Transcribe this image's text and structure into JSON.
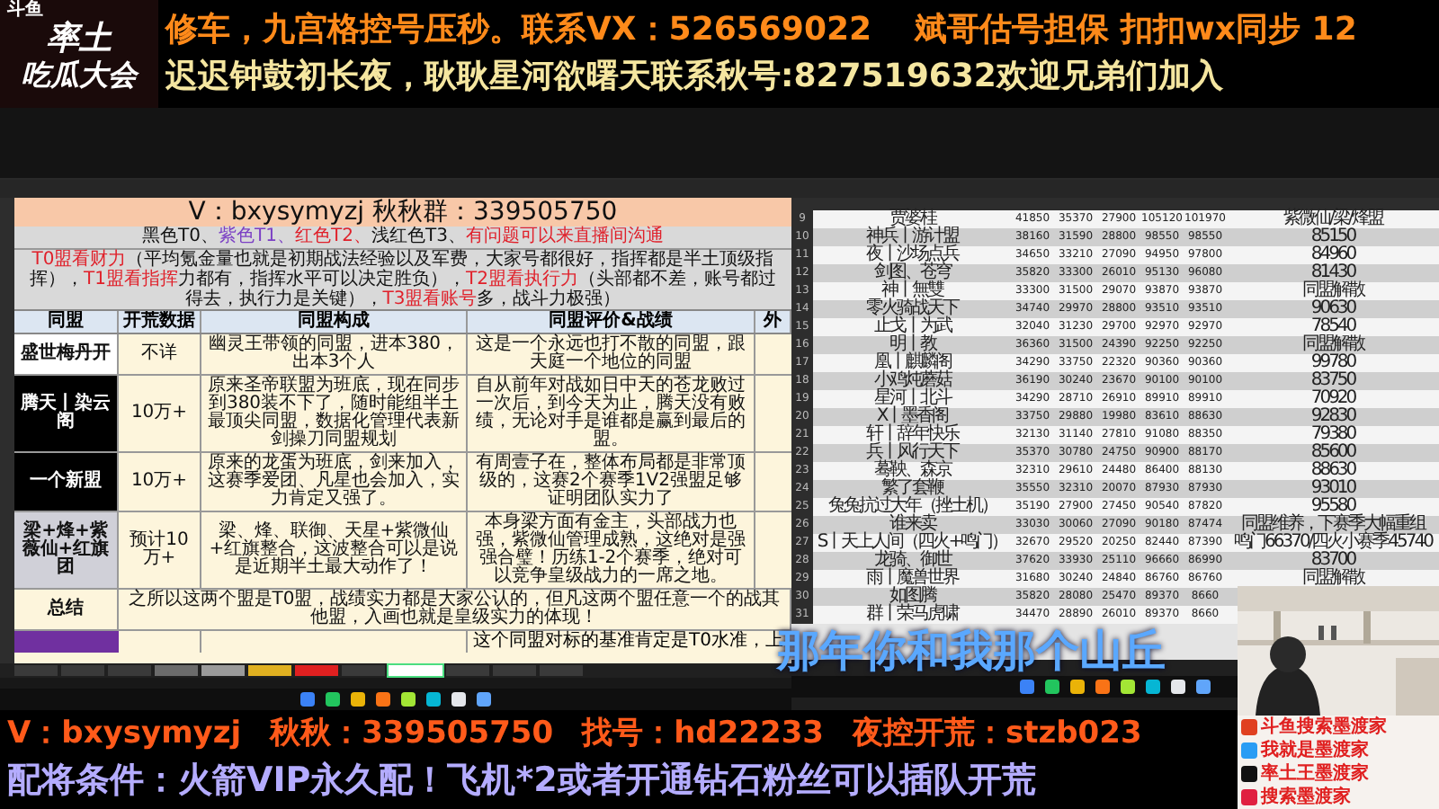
{
  "overlay_top": {
    "logo": {
      "platform": "斗鱼",
      "title_1": "率土",
      "title_2": "吃瓜大会"
    },
    "lines": [
      "修车，九宫格控号压秒。联系VX：526569022",
      "斌哥估号担保 扣扣wx同步 12",
      "迟迟钟鼓初长夜，耿耿星河欲曙天联系秋号:827519632欢迎兄弟们加入"
    ]
  },
  "left_sheet": {
    "banner": "V：bxysymyzj 秋秋群：339505750",
    "legend": [
      {
        "text": "黑色T0、",
        "color": "#111111"
      },
      {
        "text": "紫色T1、",
        "color": "#7b3fc4"
      },
      {
        "text": "红色T2、",
        "color": "#e0202a"
      },
      {
        "text": "浅红色T3、",
        "color": "#111111"
      },
      {
        "text": "有问题可以来直播间沟通",
        "color": "#e0202a"
      }
    ],
    "description": [
      {
        "text": "T0盟看财力",
        "color": "#e0202a"
      },
      {
        "text": "（平均氪金量也就是初期战法经验以及军费，大家号都很好，指挥都是半土顶级指挥），",
        "color": "#111111"
      },
      {
        "text": "T1盟看指挥",
        "color": "#e0202a"
      },
      {
        "text": "力都有，指挥水平可以决定胜负），",
        "color": "#111111"
      },
      {
        "text": "T2盟看执行力",
        "color": "#e0202a"
      },
      {
        "text": "（头部都不差，账号都过得去，执行力是关键），",
        "color": "#111111"
      },
      {
        "text": "T3盟看账号",
        "color": "#e0202a"
      },
      {
        "text": "多，战斗力极强）",
        "color": "#111111"
      }
    ],
    "columns": [
      "同盟",
      "开荒数据",
      "同盟构成",
      "同盟评价&战绩",
      "外"
    ],
    "rows": [
      {
        "kind": "row",
        "color": "#ffffff",
        "cells": [
          "盛世梅丹开",
          "不详",
          "幽灵王带领的同盟，进本380，出本3个人",
          "这是一个永远也打不散的同盟，跟天庭一个地位的同盟"
        ]
      },
      {
        "kind": "row",
        "color": "#000000",
        "cells": [
          "腾天丨染云阁",
          "10万+",
          "原来圣帝联盟为班底，现在同步到380装不下了，随时能组半土最顶尖同盟，数据化管理代表新剑操刀同盟规划",
          "自从前年对战如日中天的苍龙败过一次后，到今天为止，腾天没有败绩，无论对手是谁都是赢到最后的盟。"
        ]
      },
      {
        "kind": "row",
        "color": "#000000",
        "cells": [
          "一个新盟",
          "10万+",
          "原来的龙蛋为班底，剑来加入，这赛季爱团、凡星也会加入，实力肯定又强了。",
          "有周壹子在，整体布局都是非常顶级的，这赛2个赛季1V2强盟足够证明团队实力了"
        ]
      },
      {
        "kind": "row",
        "color": "#d0d0d8",
        "cells": [
          "梁+烽+紫薇仙+红旗团",
          "预计10万+",
          "梁、烽、联御、天星+紫微仙+红旗整合，这波整合可以是说是近期半土最大动作了！",
          "本身梁方面有金主，头部战力也强，紫微仙管理成熟，这绝对是强强合璧！历练1-2个赛季，绝对可以竞争皇级战力的一席之地。"
        ]
      },
      {
        "kind": "merged",
        "color": "#fdf5dc",
        "cells": [
          "总结",
          "之所以这两个盟是T0盟，战绩实力都是大家公认的，但凡这两个盟任意一个的战其他盟，入画也就是皇级实力的体现！"
        ]
      },
      {
        "kind": "partial",
        "color": "#7030a0",
        "cells": [
          null,
          null,
          null,
          "这个同盟对标的基准肯定是T0水准，上"
        ]
      }
    ],
    "sheet_tabs": [
      {
        "color": "#3a3a3a",
        "selected": false
      },
      {
        "color": "#3a3a3a",
        "selected": false
      },
      {
        "color": "#3a3a3a",
        "selected": false
      },
      {
        "color": "#6b6b6b",
        "selected": false
      },
      {
        "color": "#9a9a9a",
        "selected": false
      },
      {
        "color": "#e0b020",
        "selected": false
      },
      {
        "color": "#e02020",
        "selected": false
      },
      {
        "color": "#3a3a3a",
        "selected": false
      },
      {
        "color": "#ffffff",
        "selected": true
      },
      {
        "color": "#3a3a3a",
        "selected": false
      },
      {
        "color": "#3a3a3a",
        "selected": false
      },
      {
        "color": "#3a3a3a",
        "selected": false
      }
    ]
  },
  "right_sheet": {
    "rows": [
      {
        "number": "9",
        "cells": [
          "贾婆桂",
          "41850",
          "35370",
          "27900",
          "105120",
          "101970",
          "紫微仙/梁/烽盟"
        ]
      },
      {
        "number": "10",
        "cells": [
          "神兵丨游计盟",
          "38160",
          "31590",
          "28800",
          "98550",
          "98550",
          "85150"
        ]
      },
      {
        "number": "11",
        "cells": [
          "夜丨沙场点兵",
          "34650",
          "33210",
          "27090",
          "94950",
          "97800",
          "84960"
        ]
      },
      {
        "number": "12",
        "cells": [
          "剑图、苍穹",
          "35820",
          "33300",
          "26010",
          "95130",
          "96080",
          "81430"
        ]
      },
      {
        "number": "13",
        "cells": [
          "神丨無雙",
          "33300",
          "31500",
          "29070",
          "93870",
          "93870",
          "同盟解散"
        ]
      },
      {
        "number": "14",
        "cells": [
          "零火骑战天下",
          "34740",
          "29970",
          "28800",
          "93510",
          "93510",
          "90630"
        ]
      },
      {
        "number": "15",
        "cells": [
          "止戈丨为武",
          "32040",
          "31230",
          "29700",
          "92970",
          "92970",
          "78540"
        ]
      },
      {
        "number": "16",
        "cells": [
          "明丨教",
          "36360",
          "31500",
          "24390",
          "92250",
          "92250",
          "同盟解散"
        ]
      },
      {
        "number": "17",
        "cells": [
          "凰丨麒麟阁",
          "34290",
          "33750",
          "22320",
          "90360",
          "90360",
          "99780"
        ]
      },
      {
        "number": "18",
        "cells": [
          "小鸡炖蘑菇",
          "36190",
          "30240",
          "23670",
          "90100",
          "90100",
          "83750"
        ]
      },
      {
        "number": "19",
        "cells": [
          "星河丨北斗",
          "34290",
          "28710",
          "26910",
          "89910",
          "89910",
          "70920"
        ]
      },
      {
        "number": "20",
        "cells": [
          "X丨墨香阁",
          "33750",
          "29880",
          "19980",
          "83610",
          "88630",
          "92830"
        ]
      },
      {
        "number": "21",
        "cells": [
          "轩丨辞年快乐",
          "32130",
          "31140",
          "27810",
          "91080",
          "88350",
          "79380"
        ]
      },
      {
        "number": "22",
        "cells": [
          "兵丨风行天下",
          "35370",
          "30780",
          "24750",
          "90900",
          "88170",
          "85600"
        ]
      },
      {
        "number": "23",
        "cells": [
          "蓦鞅、森京",
          "32310",
          "29610",
          "24480",
          "86400",
          "88130",
          "88630"
        ]
      },
      {
        "number": "24",
        "cells": [
          "繁了套鞭",
          "35550",
          "32310",
          "20070",
          "87930",
          "87930",
          "93010"
        ]
      },
      {
        "number": "25",
        "cells": [
          "兔兔抗过大年（挫土机）",
          "35190",
          "27900",
          "27450",
          "90540",
          "87820",
          "95580"
        ]
      },
      {
        "number": "26",
        "cells": [
          "谁来卖",
          "33030",
          "30060",
          "27090",
          "90180",
          "87474",
          "同盟维养，下赛季大幅重组"
        ]
      },
      {
        "number": "27",
        "cells": [
          "S丨天上人间（四火+鸣门）",
          "32670",
          "29520",
          "20250",
          "82440",
          "87390",
          "鸣门66370/四火小赛季45740"
        ]
      },
      {
        "number": "28",
        "cells": [
          "龙骑、御世",
          "37620",
          "33930",
          "25110",
          "96660",
          "86990",
          "83700"
        ]
      },
      {
        "number": "29",
        "cells": [
          "雨丨魔兽世界",
          "31680",
          "30240",
          "24840",
          "86760",
          "86760",
          "同盟解散"
        ]
      },
      {
        "number": "30",
        "cells": [
          "如图腾",
          "35820",
          "28080",
          "25470",
          "89370",
          "8660",
          null
        ]
      },
      {
        "number": "31",
        "cells": [
          "群丨荣马虎啸",
          "34470",
          "28890",
          "26010",
          "89370",
          "8660",
          null
        ]
      }
    ]
  },
  "lyric": "那年你和我那个山丘",
  "overlay_bottom": {
    "line1": [
      "V：bxysymyzj",
      "秋秋：339505750",
      "找号：hd22233",
      "夜控开荒：stzb023"
    ],
    "line2": "配将条件：火箭VIP永久配！飞机*2或者开通钻石粉丝可以插队开荒"
  },
  "webcam": {
    "labels": [
      "斗鱼搜索墨渡家",
      "我就是墨渡家",
      "率土王墨渡家",
      "搜索墨渡家"
    ]
  }
}
